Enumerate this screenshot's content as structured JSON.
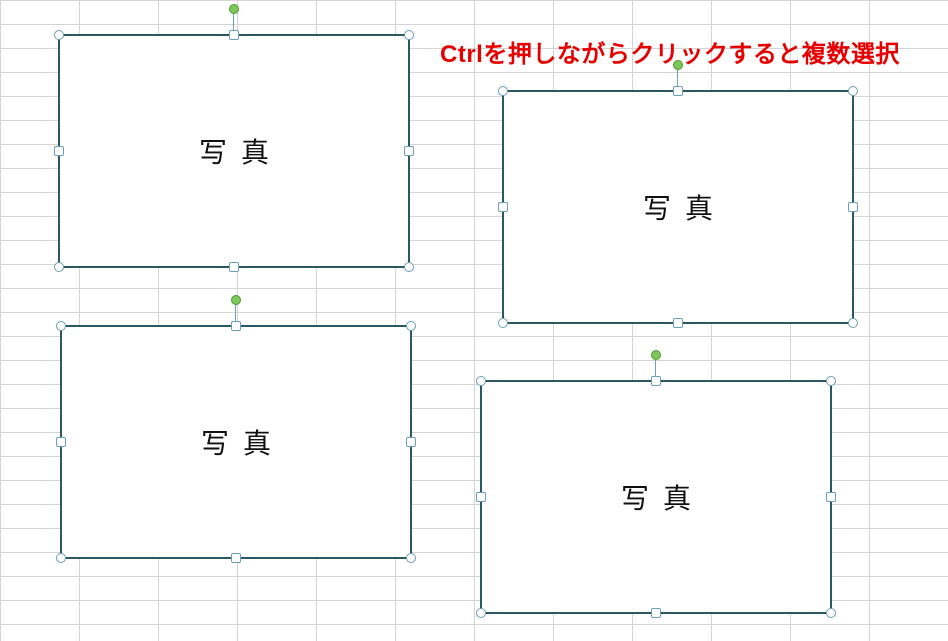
{
  "instruction": "Ctrlを押しながらクリックすると複数選択",
  "shapes": {
    "s1": {
      "label": "写真"
    },
    "s2": {
      "label": "写真"
    },
    "s3": {
      "label": "写真"
    },
    "s4": {
      "label": "写真"
    }
  },
  "colors": {
    "instruction": "#e60000",
    "shapeBorder": "#2b5763",
    "handleBorder": "#6b9fb3",
    "rotateHandle": "#7cc65b",
    "gridLine": "#d4d4d4"
  }
}
